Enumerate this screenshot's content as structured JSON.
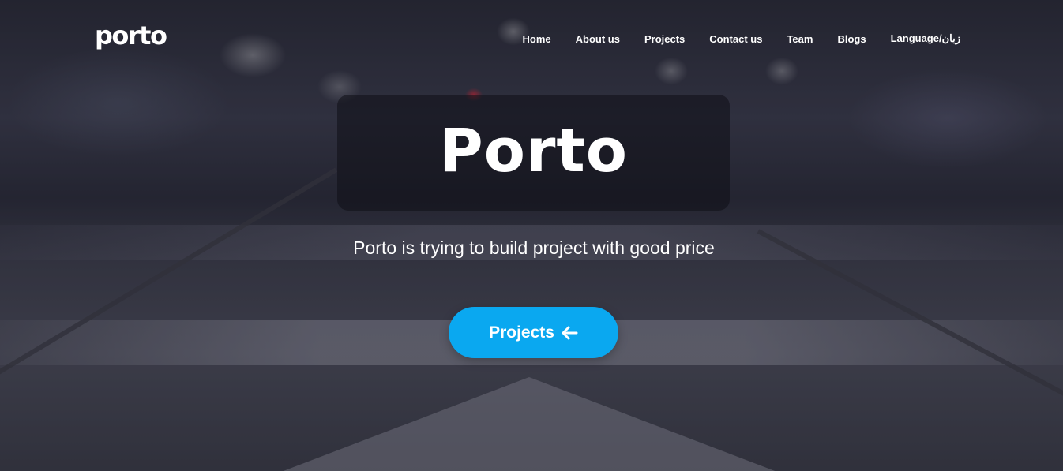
{
  "header": {
    "logo_text": "porto",
    "nav": [
      {
        "label": "Home",
        "name": "nav-home"
      },
      {
        "label": "About us",
        "name": "nav-about-us"
      },
      {
        "label": "Projects",
        "name": "nav-projects"
      },
      {
        "label": "Contact us",
        "name": "nav-contact-us"
      },
      {
        "label": "Team",
        "name": "nav-team"
      },
      {
        "label": "Blogs",
        "name": "nav-blogs"
      },
      {
        "label": "Language/زبان",
        "name": "nav-language"
      }
    ]
  },
  "hero": {
    "title": "Porto",
    "subtitle": "Porto is trying to build project with good price",
    "cta_label": "Projects",
    "cta_icon": "arrow-left-icon"
  },
  "colors": {
    "accent": "#0aa8f0",
    "text": "#ffffff"
  }
}
